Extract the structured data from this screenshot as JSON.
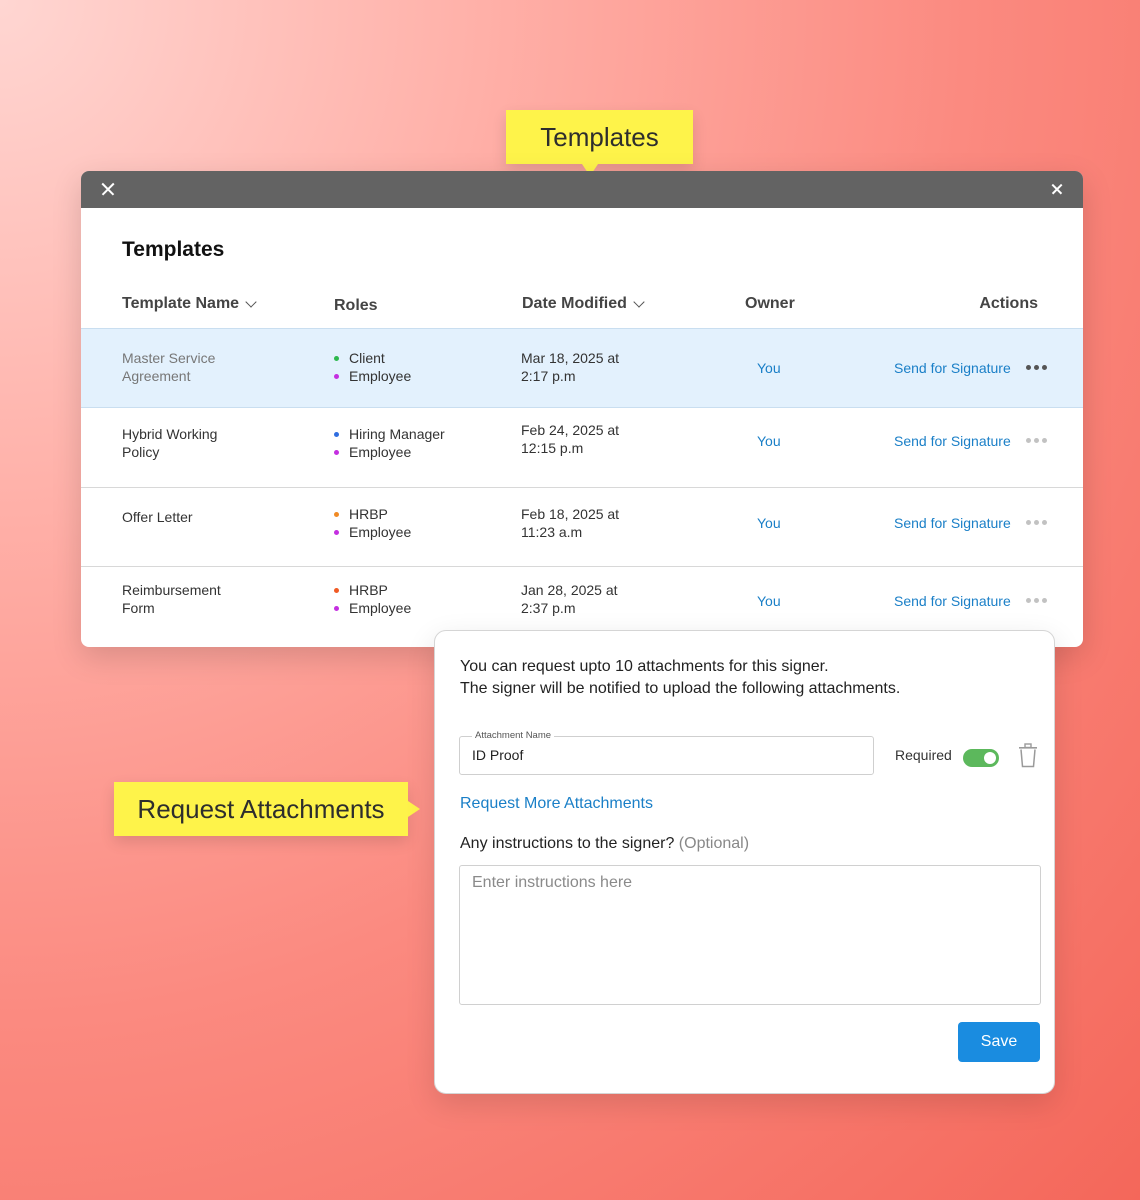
{
  "callouts": {
    "templates": "Templates",
    "attachments": "Request Attachments"
  },
  "window": {
    "title": "Templates",
    "columns": {
      "name": "Template Name",
      "roles": "Roles",
      "date": "Date Modified",
      "owner": "Owner",
      "actions": "Actions"
    },
    "rows": [
      {
        "name_line1": "Master Service",
        "name_line2": "Agreement",
        "role1": "Client",
        "role1_color": "#2db84d",
        "role2": "Employee",
        "role2_color": "#c42fe0",
        "date_line1": "Mar 18, 2025 at",
        "date_line2": "2:17 p.m",
        "owner": "You",
        "action": "Send for Signature",
        "selected": true
      },
      {
        "name_line1": "Hybrid Working",
        "name_line2": "Policy",
        "role1": "Hiring Manager",
        "role1_color": "#2f6de0",
        "role2": "Employee",
        "role2_color": "#c42fe0",
        "date_line1": "Feb 24, 2025 at",
        "date_line2": "12:15 p.m",
        "owner": "You",
        "action": "Send for Signature",
        "selected": false
      },
      {
        "name_line1": "Offer Letter",
        "name_line2": "",
        "role1": "HRBP",
        "role1_color": "#f08a24",
        "role2": "Employee",
        "role2_color": "#c42fe0",
        "date_line1": "Feb 18, 2025 at",
        "date_line2": "11:23 a.m",
        "owner": "You",
        "action": "Send for Signature",
        "selected": false
      },
      {
        "name_line1": "Reimbursement",
        "name_line2": "Form",
        "role1": "HRBP",
        "role1_color": "#f05a24",
        "role2": "Employee",
        "role2_color": "#c42fe0",
        "date_line1": "Jan 28, 2025 at",
        "date_line2": "2:37 p.m",
        "owner": "You",
        "action": "Send for Signature",
        "selected": false
      }
    ]
  },
  "panel": {
    "intro_line1": "You can request upto 10 attachments for this signer.",
    "intro_line2": "The signer will be notified to upload the following attachments.",
    "field_label": "Attachment Name",
    "field_value": "ID Proof",
    "required_label": "Required",
    "required_on": true,
    "more_link": "Request More Attachments",
    "question": "Any instructions to the signer?",
    "question_optional": "(Optional)",
    "instructions_placeholder": "Enter instructions here",
    "save_label": "Save"
  },
  "icons": {
    "close": "close-icon",
    "chevron": "chevron-down-icon",
    "more": "more-horizontal-icon",
    "trash": "trash-icon"
  }
}
